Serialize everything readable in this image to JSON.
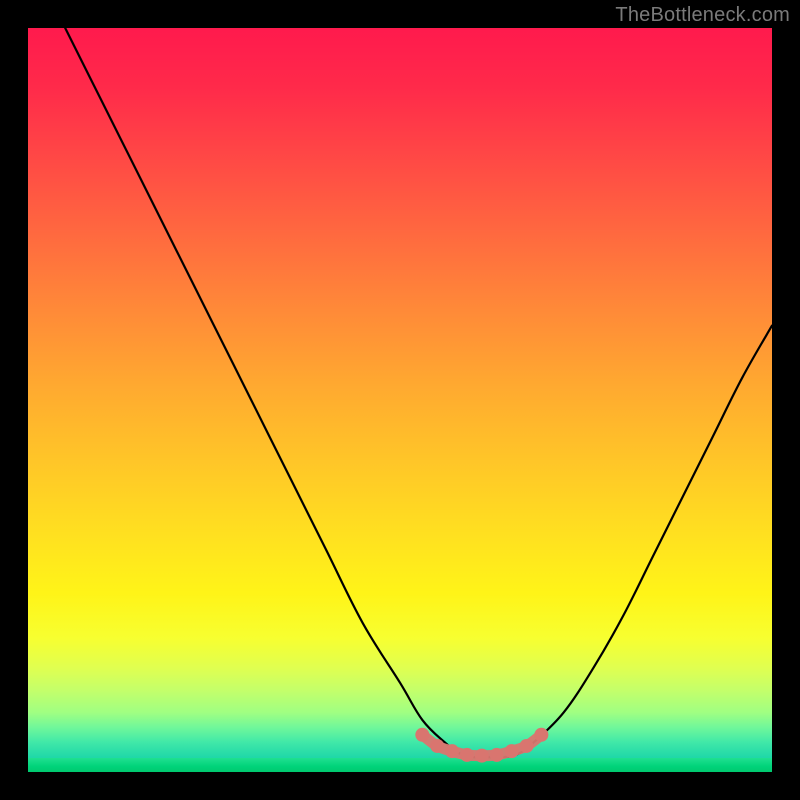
{
  "attribution": "TheBottleneck.com",
  "colors": {
    "curve": "#000000",
    "marker": "#d9756f",
    "gradient_top": "#ff1a4d",
    "gradient_bottom": "#00c96f"
  },
  "chart_data": {
    "type": "line",
    "title": "",
    "xlabel": "",
    "ylabel": "",
    "xlim": [
      0,
      100
    ],
    "ylim": [
      0,
      100
    ],
    "grid": false,
    "legend": false,
    "series": [
      {
        "name": "bottleneck-curve",
        "x": [
          5,
          10,
          15,
          20,
          25,
          30,
          35,
          40,
          45,
          50,
          53,
          56,
          58,
          60,
          62,
          64,
          66,
          68,
          72,
          76,
          80,
          84,
          88,
          92,
          96,
          100
        ],
        "y": [
          100,
          90,
          80,
          70,
          60,
          50,
          40,
          30,
          20,
          12,
          7,
          4,
          2.5,
          2,
          2,
          2,
          2.5,
          4,
          8,
          14,
          21,
          29,
          37,
          45,
          53,
          60
        ]
      }
    ],
    "annotations": [
      {
        "name": "optimal-range-markers",
        "x": [
          53,
          55,
          57,
          59,
          61,
          63,
          65,
          67,
          69
        ],
        "y": [
          5,
          3.5,
          2.8,
          2.3,
          2.2,
          2.3,
          2.8,
          3.5,
          5
        ],
        "style": "dots",
        "color": "#d9756f"
      }
    ]
  }
}
